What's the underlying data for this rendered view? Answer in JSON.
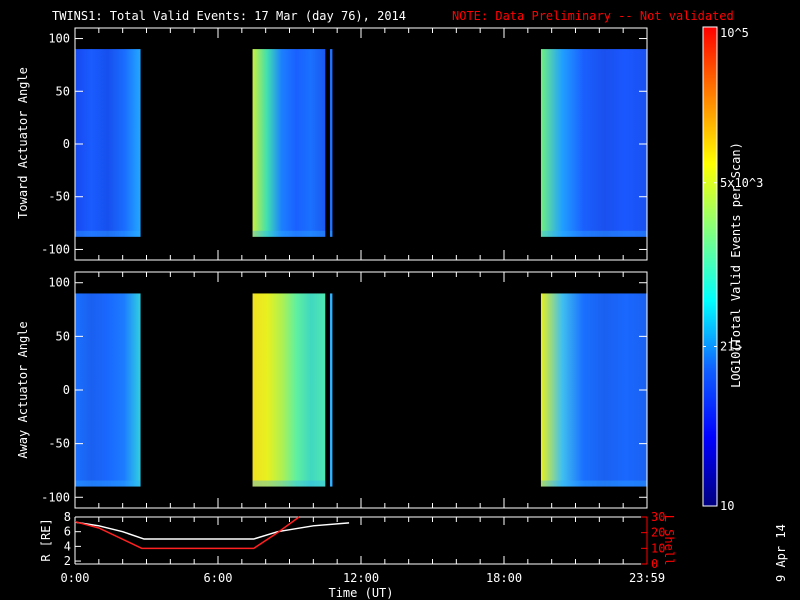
{
  "title": "TWINS1: Total Valid Events: 17 Mar (day  76), 2014",
  "note": "NOTE: Data Preliminary -- Not validated",
  "side_date": "9 Apr 14",
  "colors": {
    "bg": "#000000",
    "axis": "#ffffff",
    "note": "#ff0000",
    "lshell": "#ff2020"
  },
  "chart_data": [
    {
      "type": "heatmap",
      "ylabel": "Toward Actuator Angle",
      "ylim": [
        -110,
        110
      ],
      "yticks": [
        "100",
        "50",
        "0",
        "-50",
        "-100"
      ],
      "ytick_values": [
        100,
        50,
        0,
        -50,
        -100
      ],
      "xlim": [
        0,
        24
      ],
      "blocks": [
        {
          "start": 0,
          "end": 2.75,
          "ymin": -88,
          "ymax": 90,
          "colors": [
            "#1648f0",
            "#1a5cff",
            "#1650ee",
            "#1a6cff",
            "#22a8ff"
          ]
        },
        {
          "start": 7.45,
          "end": 10.5,
          "ymin": -88,
          "ymax": 90,
          "colors": [
            "#c8f040",
            "#40e0b0",
            "#1c80ff",
            "#1a60ff",
            "#1a70ff",
            "#1a58f0"
          ]
        },
        {
          "start": 10.7,
          "end": 10.8,
          "ymin": -88,
          "ymax": 90,
          "colors": [
            "#2070ff"
          ]
        },
        {
          "start": 19.55,
          "end": 24,
          "ymin": -88,
          "ymax": 90,
          "colors": [
            "#70f080",
            "#20a0ff",
            "#1a60ff",
            "#1a50ee",
            "#1a58ff",
            "#1a50f0"
          ]
        }
      ]
    },
    {
      "type": "heatmap",
      "ylabel": "Away Actuator Angle",
      "ylim": [
        -110,
        110
      ],
      "yticks": [
        "100",
        "50",
        "0",
        "-50",
        "-100"
      ],
      "ytick_values": [
        100,
        50,
        0,
        -50,
        -100
      ],
      "xlim": [
        0,
        24
      ],
      "blocks": [
        {
          "start": 0,
          "end": 2.75,
          "ymin": -90,
          "ymax": 90,
          "colors": [
            "#1a70ff",
            "#1a60f0",
            "#1a68ff",
            "#1c7cff",
            "#30d0e0"
          ]
        },
        {
          "start": 7.45,
          "end": 10.5,
          "ymin": -90,
          "ymax": 90,
          "colors": [
            "#f0e020",
            "#e8f020",
            "#b0f050",
            "#60f0a0",
            "#40d8c0",
            "#50e8b0"
          ]
        },
        {
          "start": 10.7,
          "end": 10.8,
          "ymin": -90,
          "ymax": 90,
          "colors": [
            "#30b0ff"
          ]
        },
        {
          "start": 19.55,
          "end": 24,
          "ymin": -90,
          "ymax": 90,
          "colors": [
            "#e8f020",
            "#40c0f0",
            "#1a70ff",
            "#1a60f0",
            "#1a68ff",
            "#1a60f0"
          ]
        }
      ]
    },
    {
      "type": "line",
      "ylabel": "R [RE]",
      "y2label": "L Shell",
      "xlabel": "Time (UT)",
      "xticks": [
        "0:00",
        "6:00",
        "12:00",
        "18:00",
        "23:59"
      ],
      "xtick_values": [
        0,
        6,
        12,
        18,
        24
      ],
      "ylim": [
        1.6,
        8
      ],
      "yticks": [
        "8",
        "6",
        "4",
        "2"
      ],
      "ytick_values": [
        8,
        6,
        4,
        2
      ],
      "y2lim": [
        0,
        30
      ],
      "y2ticks": [
        "30",
        "20",
        "10",
        "0"
      ],
      "y2tick_values": [
        30,
        20,
        10,
        0
      ],
      "series": [
        {
          "name": "R",
          "axis": "left",
          "color": "#ffffff",
          "x": [
            0,
            1,
            2,
            2.9,
            7.5,
            8.5,
            10,
            11.5
          ],
          "y": [
            7.3,
            6.8,
            6.0,
            5.0,
            5.0,
            6.0,
            6.8,
            7.2
          ]
        },
        {
          "name": "L Shell",
          "axis": "right",
          "color": "#ff2020",
          "x": [
            0,
            1,
            2.8,
            7.5,
            8.5,
            9.4
          ],
          "y": [
            27,
            23,
            10,
            10,
            20,
            30
          ]
        }
      ]
    },
    {
      "type": "colorbar",
      "label": "LOG10(Total Valid Events per Scan)",
      "ticks": [
        "10",
        "215",
        "5x10^3",
        "10^5"
      ],
      "tick_values": [
        10,
        215,
        5000,
        100000
      ],
      "colors": [
        "#000080",
        "#0000ff",
        "#1060ff",
        "#00ffff",
        "#80ff80",
        "#ffff00",
        "#ff8000",
        "#ff0000"
      ]
    }
  ]
}
